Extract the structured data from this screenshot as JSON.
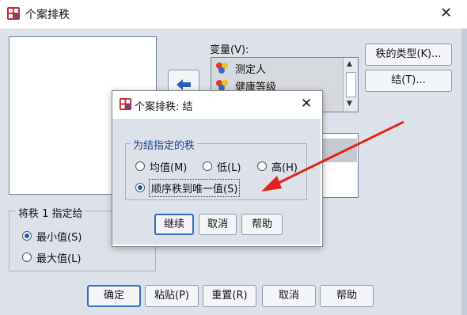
{
  "window": {
    "title": "个案排秩"
  },
  "variables": {
    "label": "变量(V):",
    "items": [
      "测定人",
      "健康等级"
    ]
  },
  "buttons_right": {
    "rank_types": "秩的类型(K)...",
    "ties": "结(T)..."
  },
  "assign_rank1": {
    "legend": "将秩 1 指定给",
    "options": [
      "最小值(S)",
      "最大值(L)"
    ],
    "selected": 0
  },
  "bottom_buttons": [
    "确定",
    "粘贴(P)",
    "重置(R)",
    "取消",
    "帮助"
  ],
  "ties_dialog": {
    "title": "个案排秩: 结",
    "group_legend": "为结指定的秩",
    "options": [
      "均值(M)",
      "低(L)",
      "高(H)",
      "顺序秩到唯一值(S)"
    ],
    "selected": 3,
    "buttons": [
      "继续",
      "取消",
      "帮助"
    ]
  },
  "colors": {
    "annotation_arrow": "#e2231a",
    "accent": "#2f6cc6"
  }
}
